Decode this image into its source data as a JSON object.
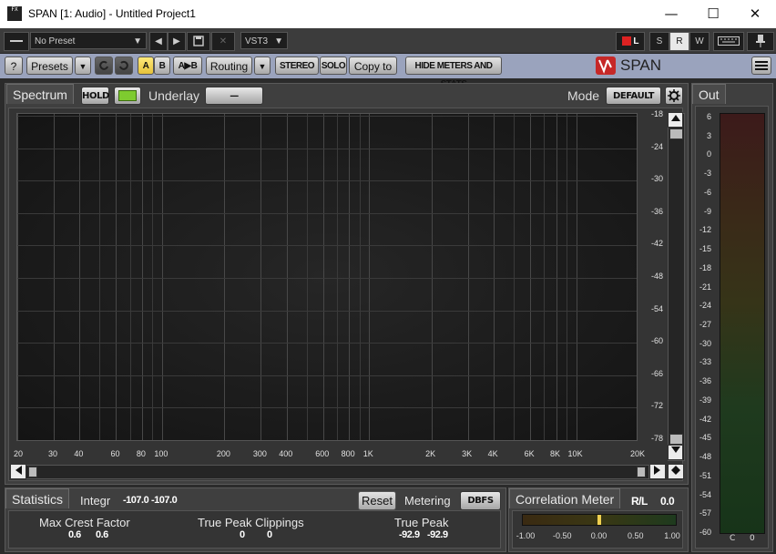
{
  "window": {
    "title": "SPAN [1: Audio] - Untitled Project1",
    "logo_text": "FX",
    "minimize": "—",
    "maximize": "☐",
    "close": "✕"
  },
  "host": {
    "menu_icon": "hamburger-icon",
    "preset": "No Preset",
    "format": "VST3",
    "mode_letters": [
      "S",
      "R",
      "W"
    ],
    "dropdown_arrow": "▼",
    "prev": "◀",
    "next": "▶",
    "save_icon": "save-icon",
    "delete": "✕",
    "keyboard_icon": "keyboard-icon",
    "pin_icon": "pin-icon",
    "al_badge": "L"
  },
  "plugin_toolbar": {
    "help": "?",
    "presets": "Presets",
    "a": "A",
    "b": "B",
    "a_to_b": "A▶B",
    "routing": "Routing",
    "stereo": "STEREO",
    "solo": "SOLO",
    "copy_to": "Copy to",
    "hide_meters": "HIDE METERS AND STATS",
    "brand": "SPAN",
    "brand_icon": "voxengo-logo-icon",
    "menu_icon": "hamburger-icon"
  },
  "spectrum": {
    "tab": "Spectrum",
    "hold": "HOLD",
    "underlay_label": "Underlay",
    "underlay_value": "—",
    "mode_label": "Mode",
    "mode_value": "DEFAULT",
    "gear_icon": "gear-icon",
    "freq_labels": [
      "20",
      "30",
      "40",
      "60",
      "80",
      "100",
      "200",
      "300",
      "400",
      "600",
      "800",
      "1K",
      "2K",
      "3K",
      "4K",
      "6K",
      "8K",
      "10K",
      "20K"
    ],
    "db_labels": [
      "-18",
      "-24",
      "-30",
      "-36",
      "-42",
      "-48",
      "-54",
      "-60",
      "-66",
      "-72",
      "-78"
    ]
  },
  "out": {
    "tab": "Out",
    "scale": [
      "6",
      "3",
      "0",
      "-3",
      "-6",
      "-9",
      "-12",
      "-15",
      "-18",
      "-21",
      "-24",
      "-27",
      "-30",
      "-33",
      "-36",
      "-39",
      "-42",
      "-45",
      "-48",
      "-51",
      "-54",
      "-57",
      "-60"
    ],
    "channels": [
      "C",
      "0"
    ]
  },
  "statistics": {
    "tab": "Statistics",
    "integr_label": "Integr",
    "integr_values": [
      "-107.0",
      "-107.0"
    ],
    "reset": "Reset",
    "metering_label": "Metering",
    "metering_value": "DBFS",
    "max_crest_label": "Max Crest Factor",
    "max_crest_values": [
      "0.6",
      "0.6"
    ],
    "tp_clip_label": "True Peak Clippings",
    "tp_clip_values": [
      "0",
      "0"
    ],
    "tp_label": "True Peak",
    "tp_values": [
      "-92.9",
      "-92.9"
    ]
  },
  "correlation": {
    "tab": "Correlation Meter",
    "rl_label": "R/L",
    "rl_value": "0.0",
    "scale": [
      "-1.00",
      "-0.50",
      "0.00",
      "0.50",
      "1.00"
    ],
    "value": 0.0
  },
  "colors": {
    "accent_blue": "#9aa3bd",
    "yellow": "#f0d050",
    "green_hold": "#7ecb2f"
  }
}
